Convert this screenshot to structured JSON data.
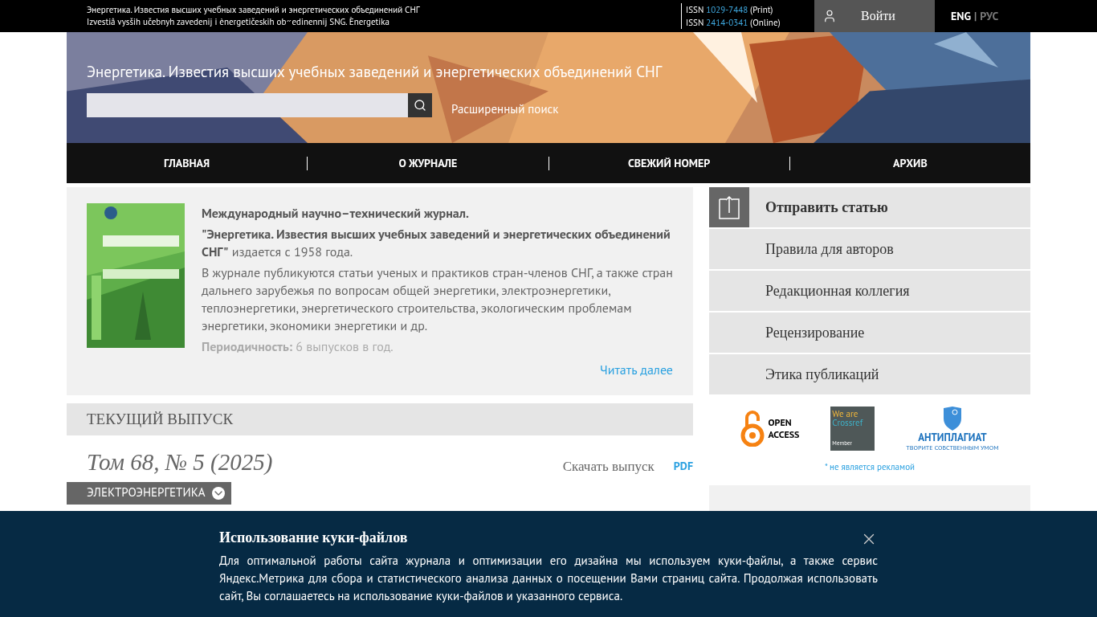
{
  "top_bar": {
    "title_ru": "Энергетика. Известия высших учебных заведений и энергетических объединений СНГ",
    "title_translit": "Izvestiâ vysših učebnyh zavedenij i ènergetičeskih ob״edinennij SNG. Ènergetika",
    "issn": [
      {
        "label": "ISSN",
        "number": "1029-7448",
        "type": "(Print)"
      },
      {
        "label": "ISSN",
        "number": "2414-0341",
        "type": "(Online)"
      }
    ],
    "login": "Войти",
    "languages": [
      {
        "label": "ENG",
        "selected": true
      },
      {
        "label": "РУС",
        "selected": false
      }
    ],
    "lang_separator": "|"
  },
  "header": {
    "title": "Энергетика. Известия высших учебных заведений и энергетических объединений СНГ",
    "advanced_search": "Расширенный поиск"
  },
  "nav": [
    "ГЛАВНАЯ",
    "О ЖУРНАЛЕ",
    "СВЕЖИЙ НОМЕР",
    "АРХИВ"
  ],
  "about": {
    "heading": "Международный научно–технический журнал.",
    "title_bold": "\"Энергетика. Известия высших учебных заведений и энергетических объединений СНГ\"",
    "title_rest": "издается с 1958 года.",
    "description": "В журнале публикуются статьи ученых и практиков стран-членов СНГ, а также стран дальнего зарубежья по вопросам общей энергетики, электроэнергетики, теплоэнергетики, энергетического строительства, экологическим проблемам энергетики, экономики энергетики и др.",
    "periodicity": "**Периодичность:** 6 выпусков в год.",
    "read_more": "Читать далее"
  },
  "current_issue": {
    "heading": "ТЕКУЩИЙ ВЫПУСК",
    "volume": "Том 68, № 5 (2025)",
    "download": "Скачать выпуск",
    "pdf": "PDF",
    "section": "ЭЛЕКТРОЭНЕРГЕТИКА"
  },
  "side_menu": [
    {
      "label": "Отправить статью",
      "kind": "primary"
    },
    {
      "label": "Правила для авторов",
      "kind": "plain"
    },
    {
      "label": "Редакционная коллегия",
      "kind": "plain"
    },
    {
      "label": "Рецензирование",
      "kind": "plain"
    },
    {
      "label": "Этика публикаций",
      "kind": "plain"
    }
  ],
  "badges": {
    "open_access": [
      "OPEN",
      "ACCESS"
    ],
    "crossref": [
      "We are",
      "Crossref",
      "Member"
    ],
    "antiplagiat": [
      "АНТИПЛАГИАТ",
      "ТВОРИТЕ СОБСТВЕННЫМ УМОМ"
    ],
    "note": "* не является рекламой"
  },
  "cookie": {
    "title": "Использование куки-файлов",
    "text": "Для оптимальной работы сайта журнала и оптимизации его дизайна мы используем куки-файлы, а также сервис Яндекс.Метрика для сбора и статистического анализа данных о посещении Вами страниц сайта. Продолжая использовать сайт, Вы соглашаетесь на использование куки-файлов и указанного сервиса."
  }
}
